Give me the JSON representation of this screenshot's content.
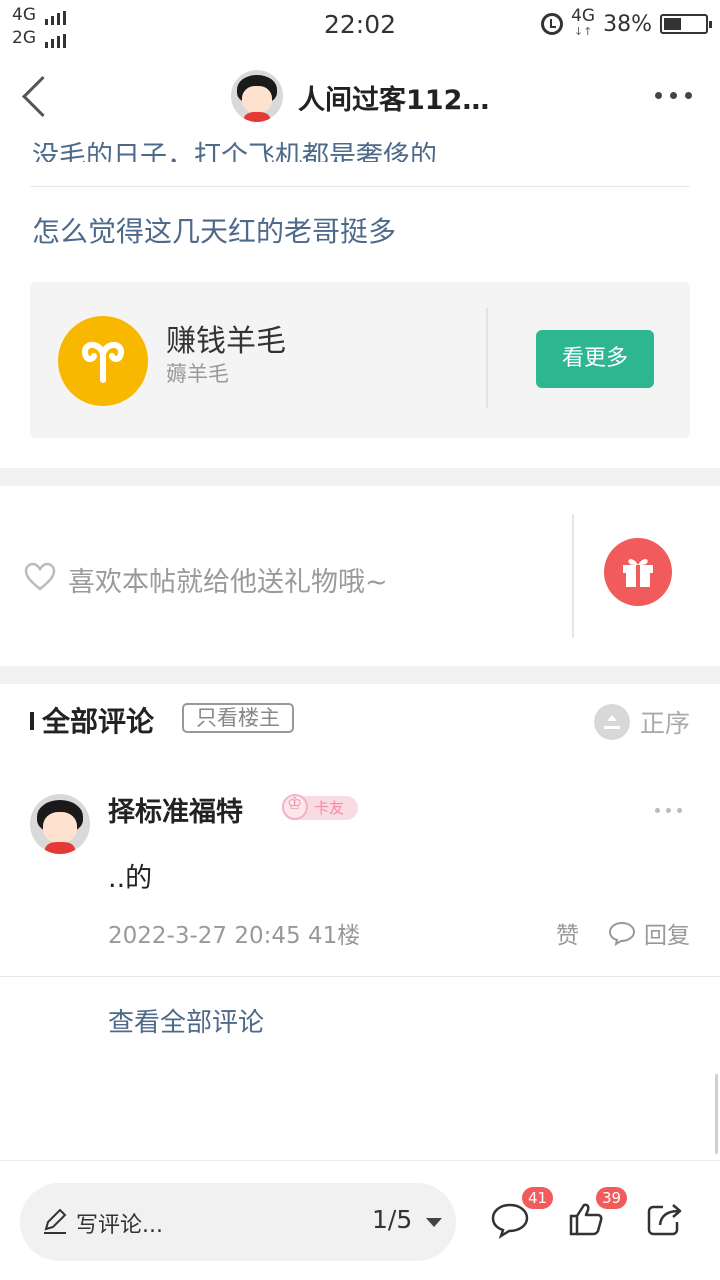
{
  "status_bar": {
    "signal_1": "4G",
    "signal_2": "2G",
    "time": "22:02",
    "network": "4G",
    "battery_text": "38%",
    "battery_level": 0.38,
    "icons": [
      "signal-icon",
      "alarm-icon",
      "battery-icon"
    ]
  },
  "header": {
    "title": "人间过客112…",
    "icons": [
      "back-icon",
      "avatar",
      "more-icon"
    ]
  },
  "post": {
    "clipped_line": "没毛的日子，打个飞机都是奢侈的",
    "line": "怎么觉得这几天红的老哥挺多"
  },
  "ad_card": {
    "name": "赚钱羊毛",
    "sub": "薅羊毛",
    "button": "看更多",
    "icon": "aries-icon",
    "accent": "#f9b800",
    "button_color": "#2db690"
  },
  "gift": {
    "prompt": "喜欢本帖就给他送礼物哦~",
    "icon": "gift-icon",
    "color": "#f25b5b"
  },
  "comments": {
    "title": "全部评论",
    "filter": "只看楼主",
    "sort": "正序",
    "items": [
      {
        "user": "择标准福特",
        "badge": "卡友",
        "text": "..的",
        "meta": "2022-3-27 20:45  41楼",
        "like": "赞",
        "reply": "回复"
      }
    ],
    "view_all": "查看全部评论"
  },
  "bottom_bar": {
    "write": "写评论...",
    "pager": "1/5",
    "comment_count": "41",
    "like_count": "39",
    "icons": [
      "pencil-icon",
      "comment-icon",
      "thumbs-up-icon",
      "share-icon"
    ]
  }
}
